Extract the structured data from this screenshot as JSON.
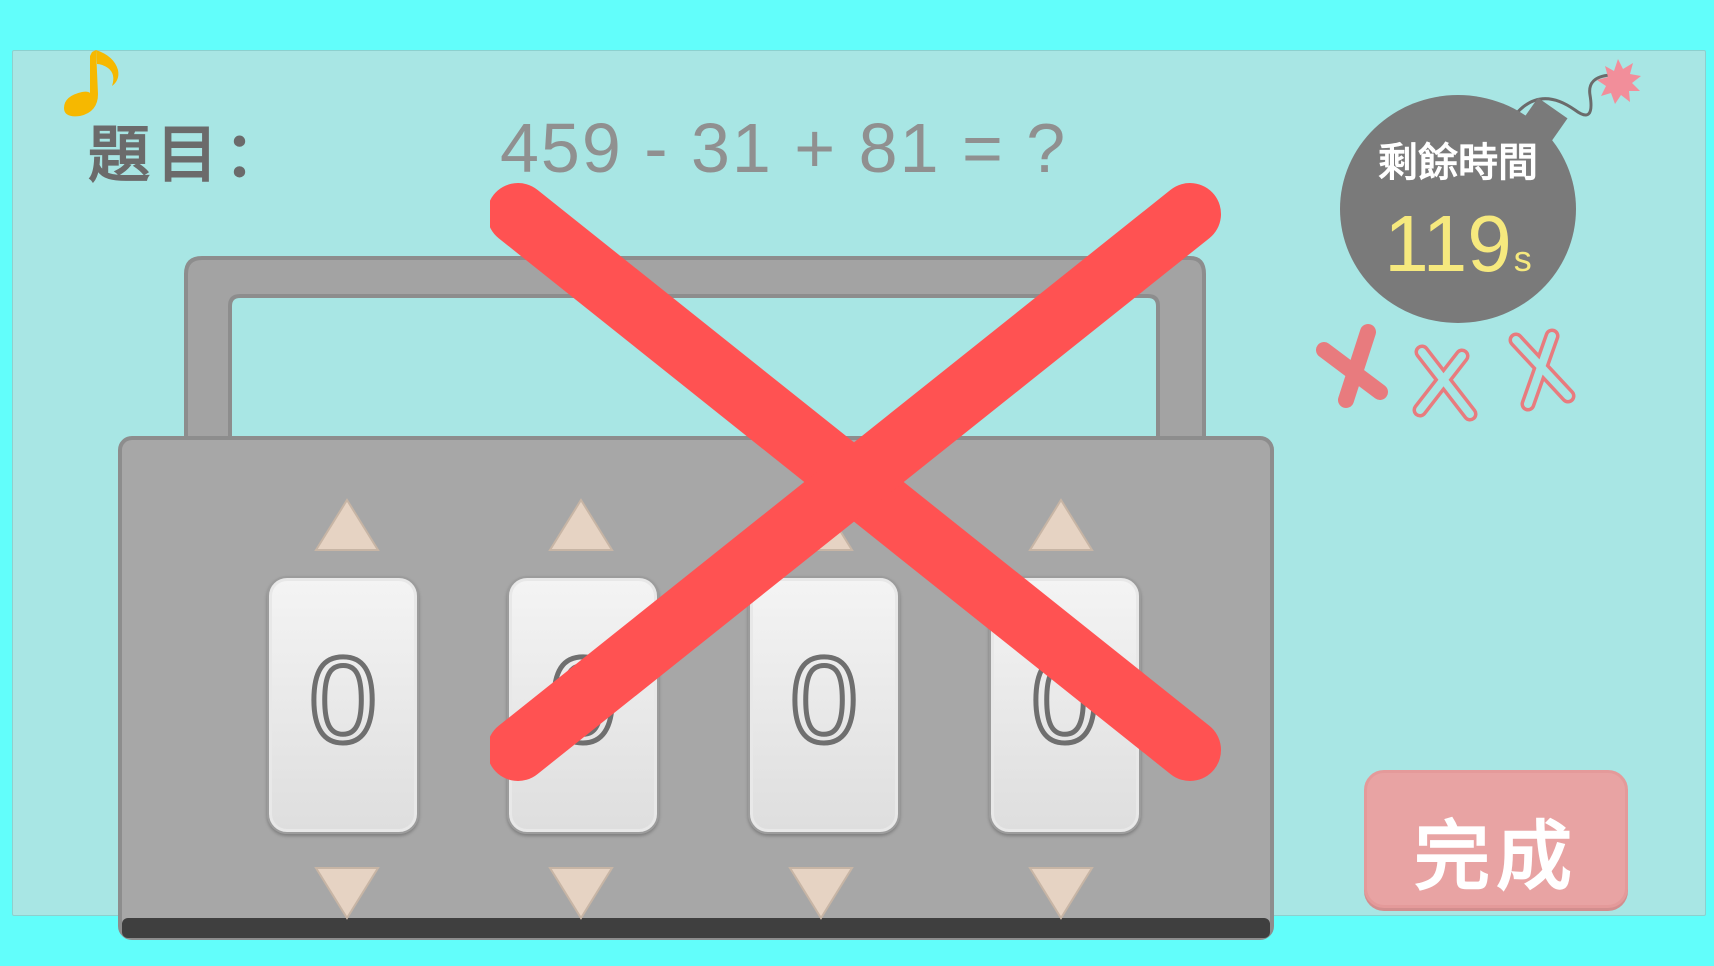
{
  "question": {
    "label": "題目：",
    "expression": "459 - 31 + 81 = ?"
  },
  "timer": {
    "title": "剩餘時間",
    "value": "119",
    "unit": "s"
  },
  "strikes": {
    "used": 1,
    "total": 3
  },
  "lock": {
    "digits": [
      "0",
      "0",
      "0",
      "0"
    ]
  },
  "done_button": {
    "label": "完成"
  },
  "colors": {
    "background": "#62fefb",
    "panel": "#a8e6e4",
    "wrong_mark": "#ff5252",
    "timer_value": "#f6e97e",
    "done_button": "#e8a3a3"
  },
  "icons": {
    "music": "music-note-icon",
    "bomb": "bomb-icon",
    "strike": "x-strike-icon",
    "wrong": "wrong-x-icon"
  }
}
